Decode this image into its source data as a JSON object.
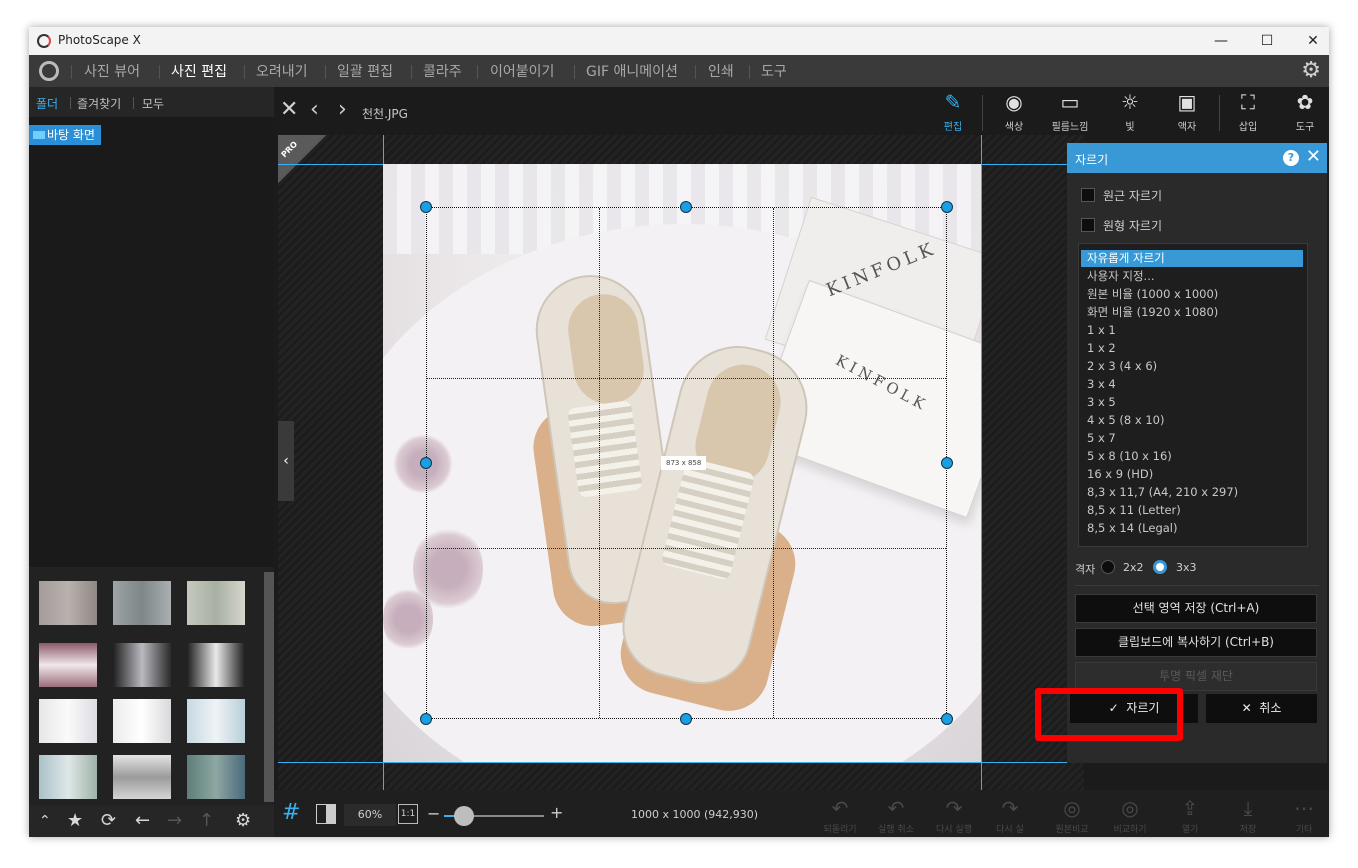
{
  "window": {
    "app_title": "PhotoScape X",
    "controls": {
      "minimize": "—",
      "maximize": "☐",
      "close": "✕"
    }
  },
  "menu": {
    "items": [
      "사진 뷰어",
      "사진 편집",
      "오려내기",
      "일괄 편집",
      "콜라주",
      "이어붙이기",
      "GIF 애니메이션",
      "인쇄",
      "도구"
    ],
    "active_index": 1,
    "settings_icon": "gear-icon"
  },
  "left_panel": {
    "tabs": [
      "폴더",
      "즐겨찾기",
      "모두"
    ],
    "active_tab": 0,
    "tree_item": "바탕 화면"
  },
  "editor": {
    "file_name": "천천.JPG",
    "toolbox": [
      "편집",
      "색상",
      "필름느낌",
      "빛",
      "액자",
      "삽입",
      "도구"
    ],
    "active_tool": 0,
    "pro_badge": "PRO",
    "crop_size_label": "873 x 858"
  },
  "photo": {
    "book_title": "KINFOLK",
    "book_title_2": "KINFOLK"
  },
  "bottom": {
    "zoom": "60%",
    "one_to_one": "1:1",
    "image_dims": "1000 x 1000 (942,930)",
    "actions": [
      "되돌리기",
      "실행 취소",
      "다시 실행",
      "다시 실",
      "원본비교",
      "비교하기",
      "열기",
      "저장",
      "기타"
    ]
  },
  "crop_panel": {
    "title": "자르기",
    "help": "?",
    "close": "✕",
    "checks": [
      "원근 자르기",
      "원형 자르기"
    ],
    "ratios": [
      "자유롭게 자르기",
      "사용자 지정...",
      "원본 비율 (1000 x 1000)",
      "화면 비율 (1920 x 1080)",
      "1 x 1",
      "1 x 2",
      "2 x 3 (4 x 6)",
      "3 x 4",
      "3 x 5",
      "4 x 5 (8 x 10)",
      "5 x 7",
      "5 x 8 (10 x 16)",
      "16 x 9 (HD)",
      "8,3 x 11,7 (A4, 210 x 297)",
      "8,5 x 11 (Letter)",
      "8,5 x 14 (Legal)"
    ],
    "selected_ratio": 0,
    "grid_label": "격자",
    "grid_options": [
      "2x2",
      "3x3"
    ],
    "grid_selected": 1,
    "save_selection": "선택 영역 저장 (Ctrl+A)",
    "copy_clipboard": "클립보드에 복사하기 (Ctrl+B)",
    "trim_transparent": "투명 픽셀 재단",
    "crop_button": "자르기",
    "cancel_button": "취소"
  },
  "colors": {
    "accent": "#3899d6",
    "highlight": "#ff0000",
    "background": "#1c1c1c"
  }
}
